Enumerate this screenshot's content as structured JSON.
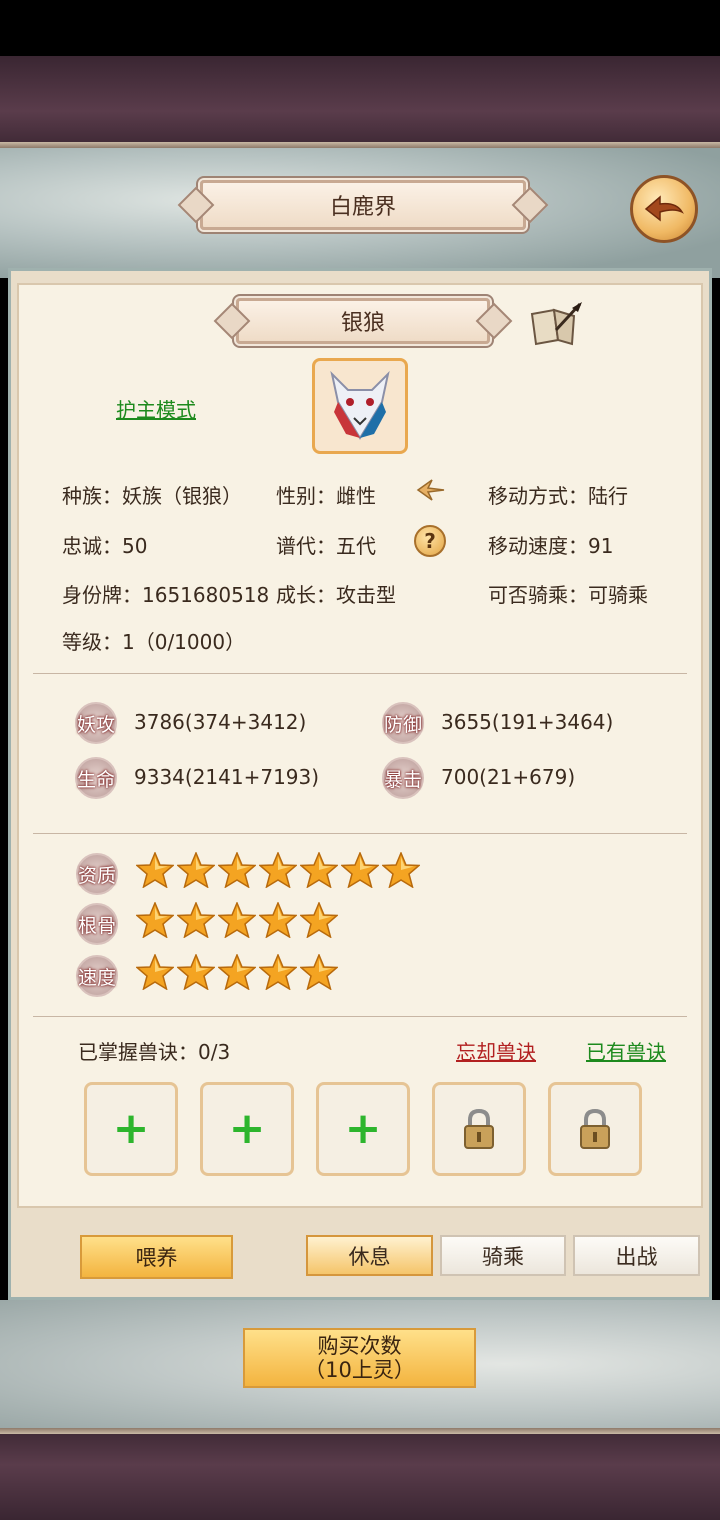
{
  "header": {
    "title": "白鹿界"
  },
  "pet": {
    "name": "银狼",
    "mode_link": "护主模式",
    "race_label": "种族：妖族（银狼）",
    "gender_label": "性别：雌性",
    "move_type_label": "移动方式：陆行",
    "loyalty_label": "忠诚：50",
    "generation_label": "谱代：五代",
    "move_speed_label": "移动速度：91",
    "id_label": "身份牌：1651680518",
    "growth_label": "成长：攻击型",
    "rideable_label": "可否骑乘：可骑乘",
    "level_label": "等级：1（0/1000）"
  },
  "stats": [
    {
      "badge": "妖攻",
      "value": "3786(374+3412)"
    },
    {
      "badge": "防御",
      "value": "3655(191+3464)"
    },
    {
      "badge": "生命",
      "value": "9334(2141+7193)"
    },
    {
      "badge": "暴击",
      "value": "700(21+679)"
    }
  ],
  "ratings": [
    {
      "label": "资质",
      "stars": 7
    },
    {
      "label": "根骨",
      "stars": 5
    },
    {
      "label": "速度",
      "stars": 5
    }
  ],
  "skills": {
    "mastered_label": "已掌握兽诀：0/3",
    "forget_link": "忘却兽诀",
    "owned_link": "已有兽诀",
    "slots": [
      "plus",
      "plus",
      "plus",
      "locked",
      "locked"
    ]
  },
  "actions": {
    "feed": "喂养",
    "tabs": [
      "休息",
      "骑乘",
      "出战"
    ],
    "active_tab": 0
  },
  "purchase": {
    "line1": "购买次数",
    "line2": "（10上灵）"
  }
}
